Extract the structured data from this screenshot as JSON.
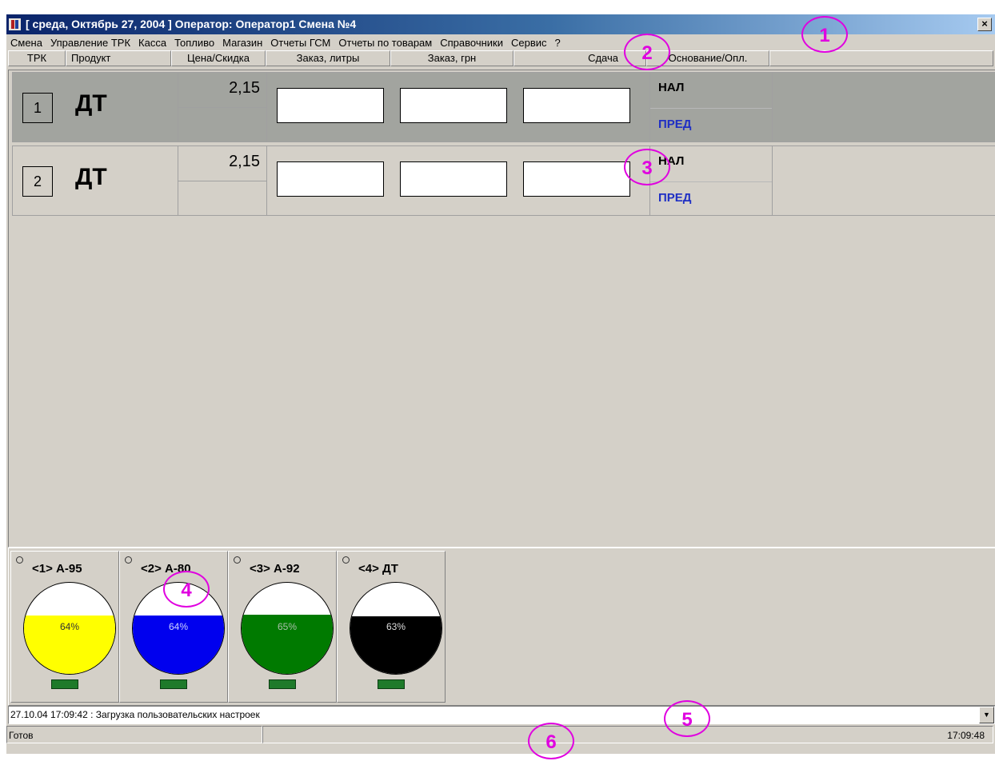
{
  "window": {
    "title": "[ среда, Октябрь 27, 2004 ]  Оператор: Оператор1  Смена №4",
    "close_glyph": "×"
  },
  "menu": [
    "Смена",
    "Управление ТРК",
    "Касса",
    "Топливо",
    "Магазин",
    "Отчеты ГСМ",
    "Отчеты по товарам",
    "Справочники",
    "Сервис",
    "?"
  ],
  "columns": [
    "ТРК",
    "Продукт",
    "Цена/Скидка",
    "Заказ, литры",
    "Заказ, грн",
    "Сдача",
    "Основание/Опл."
  ],
  "pumps": [
    {
      "number": "1",
      "product": "ДТ",
      "price": "2,15",
      "payment": "НАЛ",
      "payment_mode": "ПРЕД"
    },
    {
      "number": "2",
      "product": "ДТ",
      "price": "2,15",
      "payment": "НАЛ",
      "payment_mode": "ПРЕД"
    }
  ],
  "tanks": [
    {
      "name": "<1> А-95",
      "percent": "64%",
      "level": 0.64,
      "color": "#ffff00"
    },
    {
      "name": "<2> А-80",
      "percent": "64%",
      "level": 0.64,
      "color": "#0000ee"
    },
    {
      "name": "<3> А-92",
      "percent": "65%",
      "level": 0.65,
      "color": "#007a00"
    },
    {
      "name": "<4> ДТ",
      "percent": "63%",
      "level": 0.63,
      "color": "#000000"
    }
  ],
  "log": {
    "text": "27.10.04 17:09:42 : Загрузка пользовательских настроек"
  },
  "status": {
    "left": "Готов",
    "time": "17:09:48"
  },
  "annotation_marks": [
    "1",
    "2",
    "3",
    "4",
    "5",
    "6"
  ],
  "colors": {
    "annotation": "#e000e0",
    "selected_row": "#a2a49f",
    "pred_text": "#1f2fc4",
    "tank_indicator": "#1e7a2a"
  },
  "icons": [
    "app-icon",
    "close-icon",
    "dropdown-arrow-icon",
    "tank-status-dot-icon"
  ]
}
